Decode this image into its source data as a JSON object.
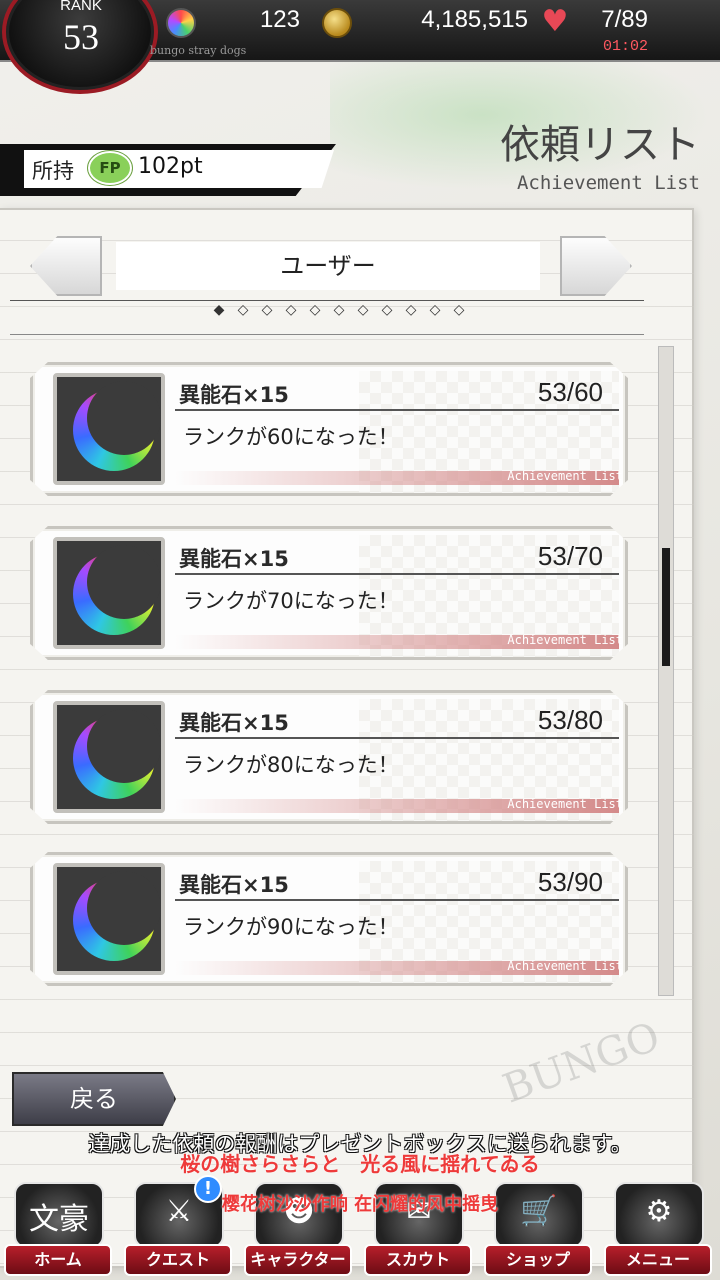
{
  "header": {
    "rank_label": "RANK",
    "rank_value": "53",
    "stone_count": "123",
    "gold_count": "4,185,515",
    "ap_count": "7/89",
    "ap_timer": "01:02",
    "game_subtitle": "bungo stray dogs"
  },
  "page": {
    "title": "依頼リスト",
    "subtitle": "Achievement List"
  },
  "fp": {
    "own_label": "所持",
    "badge": "FP",
    "value": "102pt"
  },
  "category": {
    "label": "ユーザー",
    "pager": [
      "◆",
      "◇",
      "◇",
      "◇",
      "◇",
      "◇",
      "◇",
      "◇",
      "◇",
      "◇",
      "◇"
    ]
  },
  "achievements": [
    {
      "reward": "異能石×15",
      "progress": "53/60",
      "description": "ランクが60になった！",
      "strip_label": "Achievement List"
    },
    {
      "reward": "異能石×15",
      "progress": "53/70",
      "description": "ランクが70になった！",
      "strip_label": "Achievement List"
    },
    {
      "reward": "異能石×15",
      "progress": "53/80",
      "description": "ランクが80になった！",
      "strip_label": "Achievement List"
    },
    {
      "reward": "異能石×15",
      "progress": "53/90",
      "description": "ランクが90になった！",
      "strip_label": "Achievement List"
    }
  ],
  "footer": {
    "back_label": "戻る",
    "info_text": "達成した依頼の報酬はプレゼントボックスに送られます。",
    "lyric_ja": "桜の樹さらさらと　光る風に揺れてゐる",
    "lyric_zh": "樱花树沙沙作响 在闪耀的风中摇曳",
    "watermark": "BUNGO"
  },
  "nav": {
    "items": [
      {
        "label": "ホーム",
        "art": "文豪"
      },
      {
        "label": "クエスト",
        "art": "⚔"
      },
      {
        "label": "キャラクター",
        "art": "☻"
      },
      {
        "label": "スカウト",
        "art": "✉"
      },
      {
        "label": "ショップ",
        "art": "🛒"
      },
      {
        "label": "メニュー",
        "art": "⚙"
      }
    ],
    "alert": "!"
  }
}
